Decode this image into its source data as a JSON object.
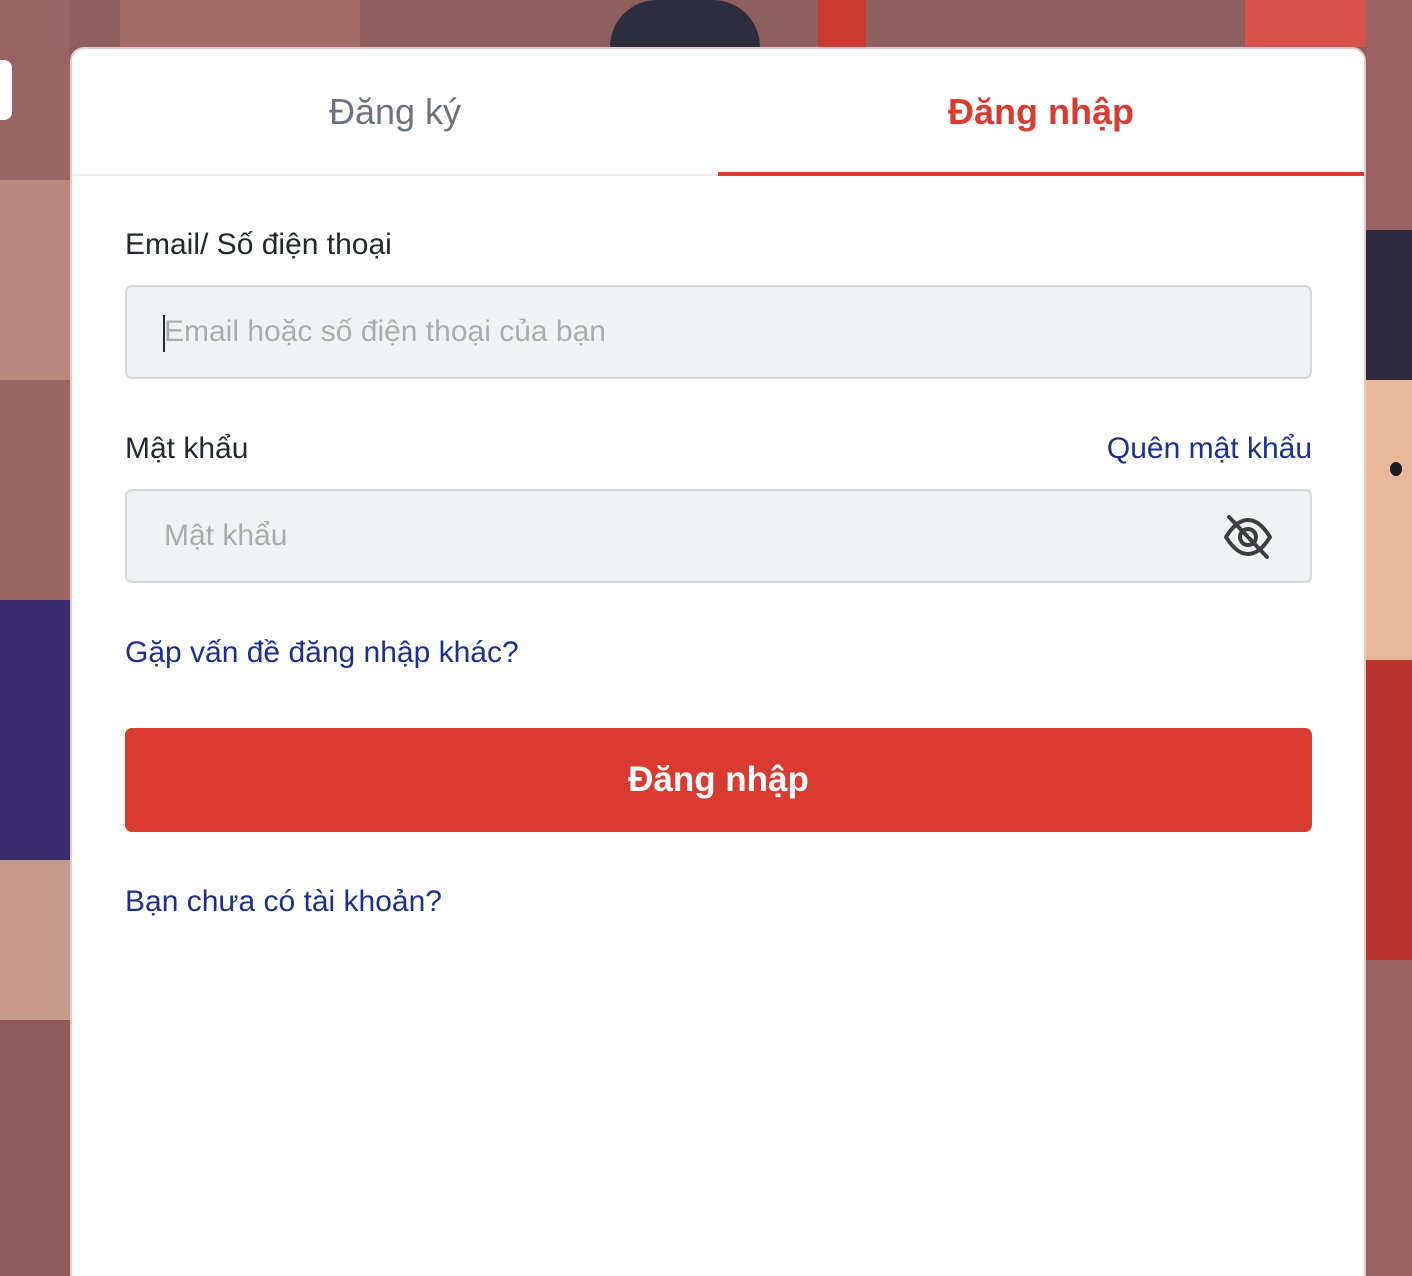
{
  "tabs": [
    {
      "label": "Đăng ký",
      "active": false
    },
    {
      "label": "Đăng nhập",
      "active": true
    }
  ],
  "form": {
    "identifier": {
      "label": "Email/ Số điện thoại",
      "placeholder": "Email hoặc số điện thoại của bạn",
      "value": ""
    },
    "password": {
      "label": "Mật khẩu",
      "placeholder": "Mật khẩu",
      "value": "",
      "forgot_link": "Quên mật khẩu",
      "visibility_icon": "eye-off-icon"
    },
    "other_issue_link": "Gặp vấn đề đăng nhập khác?",
    "submit_label": "Đăng nhập",
    "signup_link": "Bạn chưa có tài khoản?"
  },
  "colors": {
    "accent": "#d93b30",
    "link": "#1b2f8c",
    "input_bg": "#f1f2f4",
    "backdrop": "#8f5f5f"
  }
}
